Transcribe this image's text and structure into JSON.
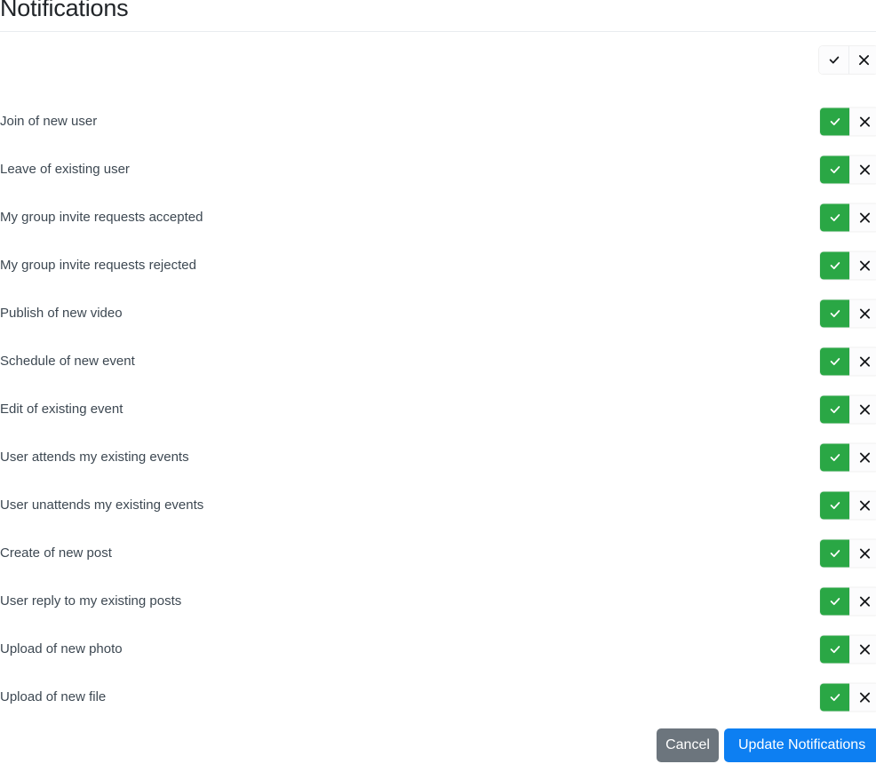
{
  "page": {
    "title": "Notifications"
  },
  "header_toggle": {
    "enable_all": {
      "label": "",
      "icon": "check-icon",
      "active": false
    },
    "disable_all": {
      "label": "",
      "icon": "close-icon",
      "active": false
    }
  },
  "toggle_icons": {
    "on": "check-icon",
    "off": "close-icon"
  },
  "rows": [
    {
      "label": "Join of new user",
      "state": "on"
    },
    {
      "label": "Leave of existing user",
      "state": "on"
    },
    {
      "label": "My group invite requests accepted",
      "state": "on"
    },
    {
      "label": "My group invite requests rejected",
      "state": "on"
    },
    {
      "label": "Publish of new video",
      "state": "on"
    },
    {
      "label": "Schedule of new event",
      "state": "on"
    },
    {
      "label": "Edit of existing event",
      "state": "on"
    },
    {
      "label": "User attends my existing events",
      "state": "on"
    },
    {
      "label": "User unattends my existing events",
      "state": "on"
    },
    {
      "label": "Create of new post",
      "state": "on"
    },
    {
      "label": "User reply to my existing posts",
      "state": "on"
    },
    {
      "label": "Upload of new photo",
      "state": "on"
    },
    {
      "label": "Upload of new file",
      "state": "on"
    }
  ],
  "footer": {
    "cancel_label": "Cancel",
    "submit_label": "Update Notifications"
  },
  "colors": {
    "toggle_on": "#2aa745",
    "toggle_off": "#fcfcfd",
    "primary": "#0d7ff2",
    "secondary": "#6c757d",
    "text": "#3d4852",
    "title": "#212529"
  }
}
